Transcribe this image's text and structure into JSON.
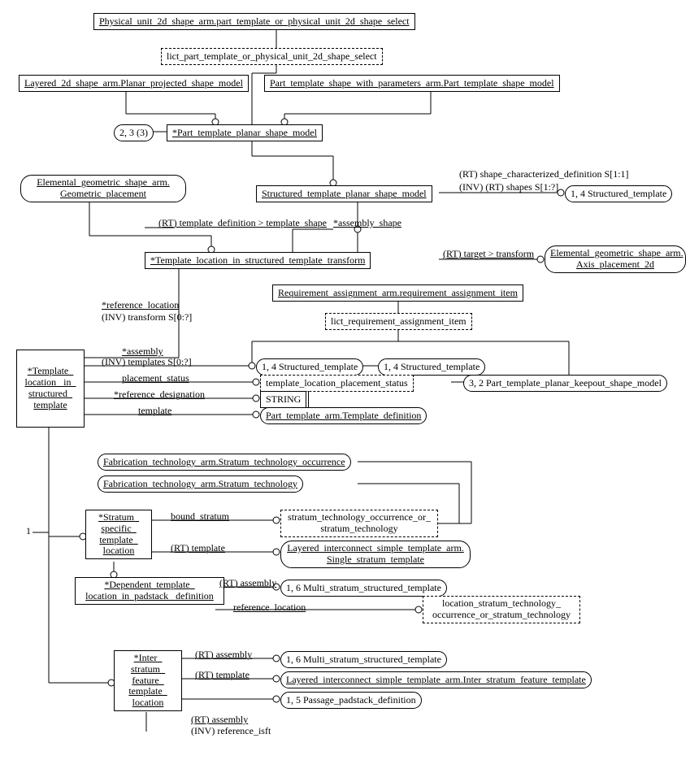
{
  "nodes": {
    "n1": "Physical_unit_2d_shape_arm.part_template_or_physical_unit_2d_shape_select",
    "n2": "lict_part_template_or_physical_unit_2d_shape_select",
    "n3": "Layered_2d_shape_arm.Planar_projected_shape_model",
    "n4": "Part_template_shape_with_parameters_arm.Part_template_shape_model",
    "n5": "*Part_template_planar_shape_model",
    "n6": "2, 3 (3)",
    "n7": "Elemental_geometric_shape_arm. Geometric_placement",
    "n8": "Structured_template_planar_shape_model",
    "n9": "1, 4 Structured_template",
    "n10": "*Template_location_in_structured_template_transform",
    "n11": "Elemental_geometric_shape_arm. Axis_placement_2d",
    "n12": "Requirement_assignment_arm.requirement_assignment_item",
    "n13": "lict_requirement_assignment_item",
    "n14": "*Template_ location_ in_ structured_ template",
    "n15": "1, 4 Structured_template",
    "n16": "1, 4 Structured_template",
    "n17": "3, 2 Part_template_planar_keepout_shape_model",
    "n18": "template_location_placement_status",
    "n19": "STRING",
    "n20": "Part_template_arm.Template_definition",
    "n21": "Fabrication_technology_arm.Stratum_technology_occurrence",
    "n22": "Fabrication_technology_arm.Stratum_technology",
    "n23": "*Stratum_ specific_ template_ location",
    "n24": "stratum_technology_occurrence_or_ stratum_technology",
    "n25": "Layered_interconnect_simple_template_arm. Single_stratum_template",
    "n26": "*Dependent_template_ location_in_padstack_ definition",
    "n27": "1, 6 Multi_stratum_structured_template",
    "n28": "location_stratum_technology_ occurrence_or_stratum_technology",
    "n29": "*Inter_ stratum_ feature_ template_ location",
    "n30": "1, 6 Multi_stratum_structured_template",
    "n31": "Layered_interconnect_simple_template_arm.Inter_stratum_feature_template",
    "n32": "1, 5 Passage_padstack_definition"
  },
  "labels": {
    "l1": "(RT) shape_characterized_definition S[1:1]",
    "l2": "(INV) (RT) shapes S[1:?]",
    "l3": "(RT) template_definition > template_shape",
    "l4": "*assembly_shape",
    "l5": "(RT) target > transform",
    "l6": "*reference_location",
    "l7": "(INV) transform S[0:?]",
    "l8": "*assembly",
    "l9": "(INV) templates S[0:?]",
    "l10": "placement_status",
    "l11": "*reference_designation",
    "l12": "template",
    "l13": "bound_stratum",
    "l14": "(RT) template",
    "l15": "(RT) assembly",
    "l16": "reference_location",
    "l17": "(RT) assembly",
    "l18": "(RT) template",
    "l19": "(RT) assembly",
    "l20": "(INV) reference_isft",
    "l21": "1"
  }
}
